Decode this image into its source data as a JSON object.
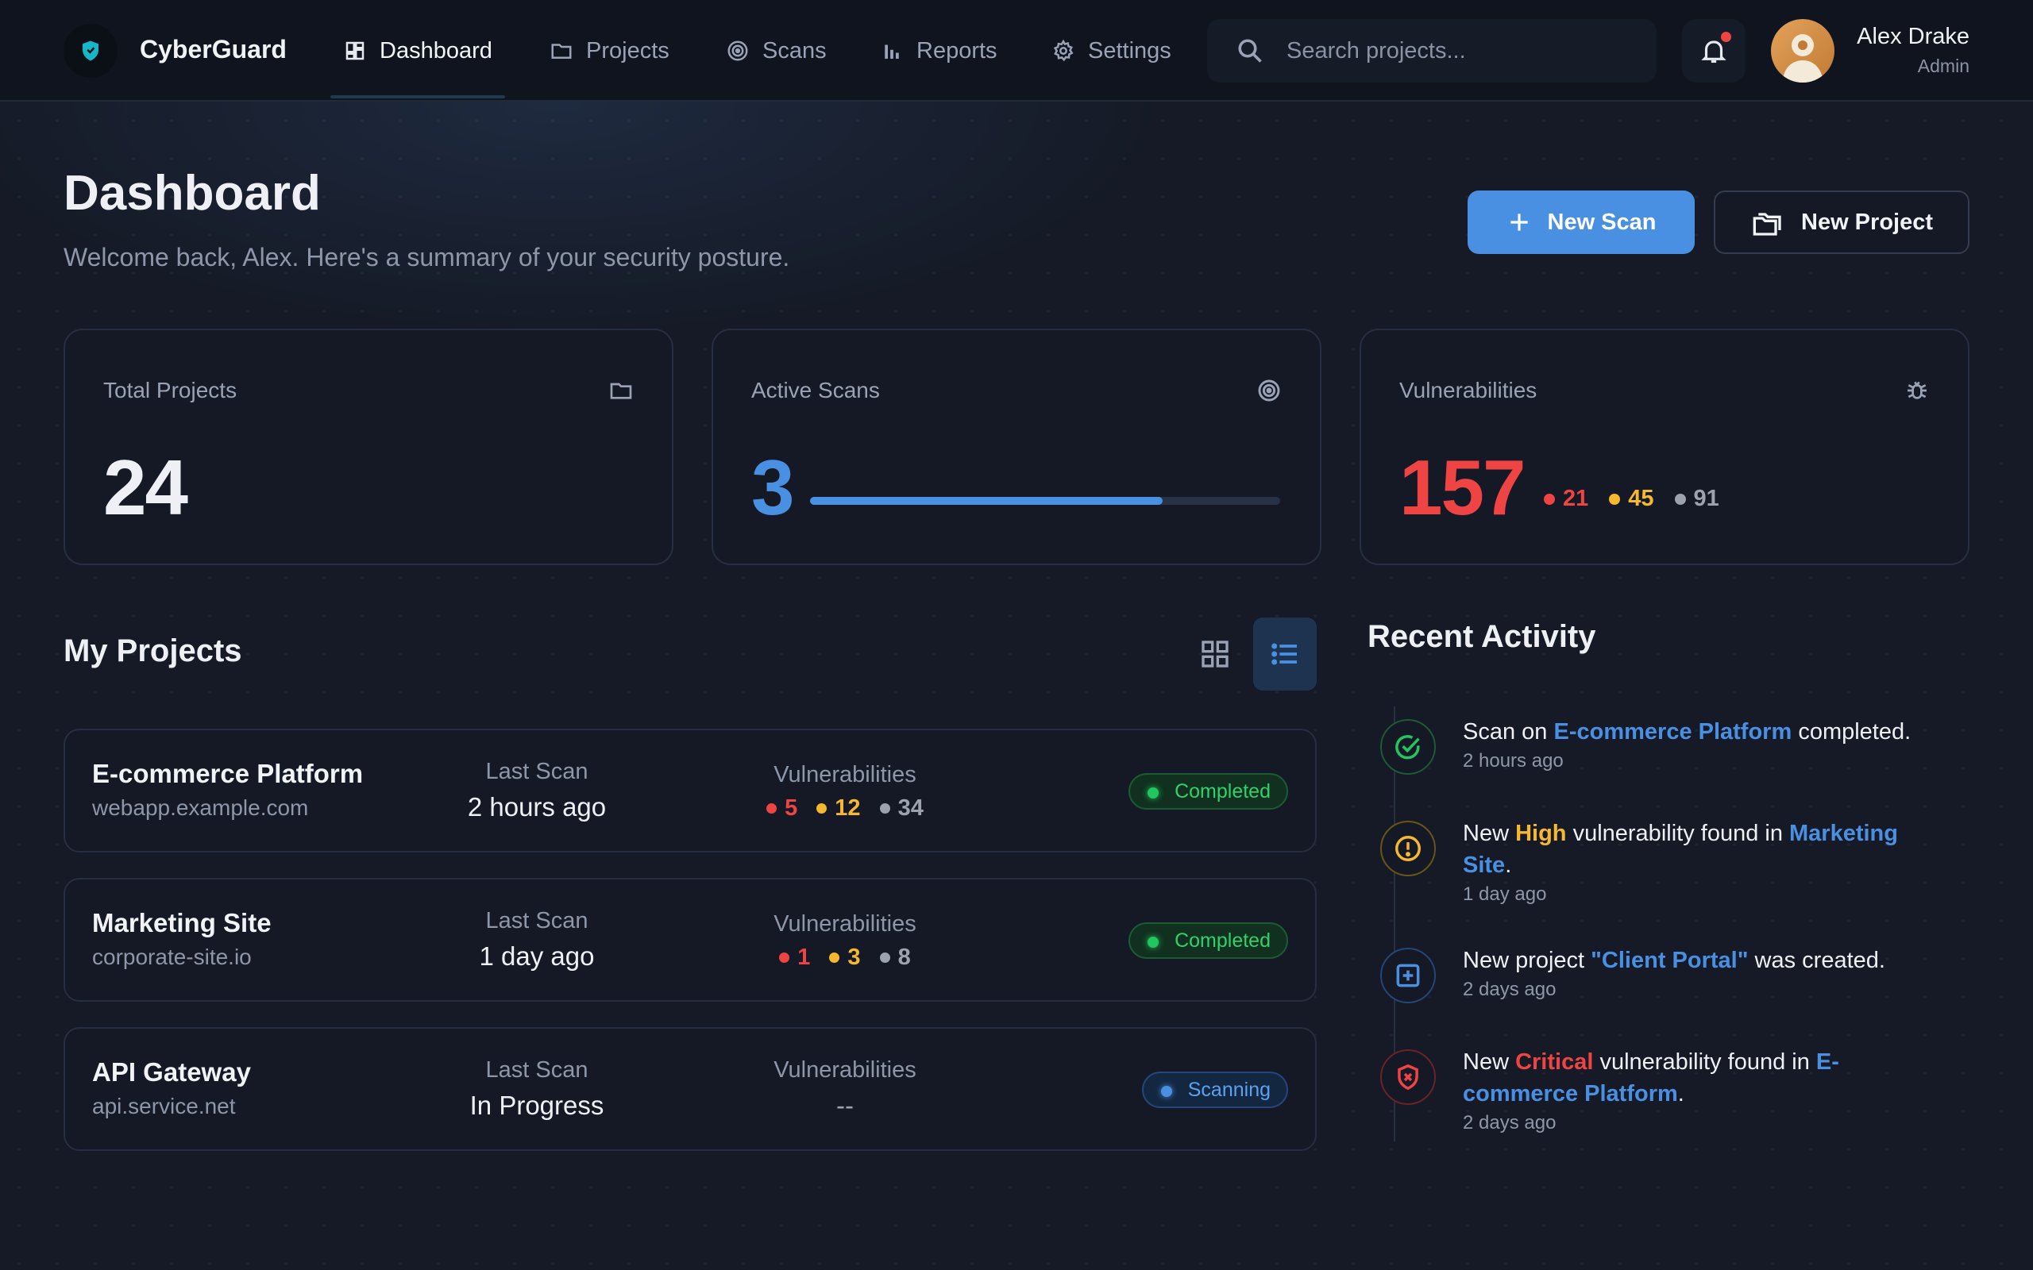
{
  "app": {
    "name": "CyberGuard"
  },
  "nav": [
    {
      "label": "Dashboard",
      "icon": "dashboard-icon",
      "active": true
    },
    {
      "label": "Projects",
      "icon": "folder-icon",
      "active": false
    },
    {
      "label": "Scans",
      "icon": "target-icon",
      "active": false
    },
    {
      "label": "Reports",
      "icon": "bar-chart-icon",
      "active": false
    },
    {
      "label": "Settings",
      "icon": "gear-icon",
      "active": false
    }
  ],
  "search": {
    "placeholder": "Search projects..."
  },
  "notifications": {
    "has_unread": true
  },
  "user": {
    "name": "Alex Drake",
    "role": "Admin"
  },
  "header": {
    "title": "Dashboard",
    "subtitle": "Welcome back, Alex. Here's a summary of your security posture.",
    "new_scan_label": "New Scan",
    "new_project_label": "New Project"
  },
  "stats": {
    "total_projects": {
      "label": "Total Projects",
      "value": "24"
    },
    "active_scans": {
      "label": "Active Scans",
      "value": "3",
      "progress": 0.75
    },
    "vulnerabilities": {
      "label": "Vulnerabilities",
      "value": "157",
      "critical": "21",
      "high": "45",
      "low": "91"
    }
  },
  "projects": {
    "title": "My Projects",
    "view": "list",
    "last_scan_label": "Last Scan",
    "vulns_label": "Vulnerabilities",
    "items": [
      {
        "name": "E-commerce Platform",
        "url": "webapp.example.com",
        "last_scan": "2 hours ago",
        "critical": "5",
        "high": "12",
        "low": "34",
        "status": "Completed",
        "state": "completed"
      },
      {
        "name": "Marketing Site",
        "url": "corporate-site.io",
        "last_scan": "1 day ago",
        "critical": "1",
        "high": "3",
        "low": "8",
        "status": "Completed",
        "state": "completed"
      },
      {
        "name": "API Gateway",
        "url": "api.service.net",
        "last_scan": "In Progress",
        "vulns_placeholder": "--",
        "status": "Scanning",
        "state": "scanning"
      }
    ]
  },
  "activity": {
    "title": "Recent Activity",
    "items": [
      {
        "icon": "check-circle-icon",
        "parts": [
          "Scan on ",
          "E-commerce Platform",
          " completed."
        ],
        "time": "2 hours ago"
      },
      {
        "icon": "alert-circle-icon",
        "parts": [
          "New ",
          "High",
          " vulnerability found in ",
          "Marketing Site",
          "."
        ],
        "time": "1 day ago"
      },
      {
        "icon": "plus-square-icon",
        "parts": [
          "New project ",
          "\"Client Portal\"",
          " was created."
        ],
        "time": "2 days ago"
      },
      {
        "icon": "shield-x-icon",
        "parts": [
          "New ",
          "Critical",
          " vulnerability found in ",
          "E-commerce Platform",
          "."
        ],
        "time": "2 days ago"
      }
    ]
  },
  "colors": {
    "accent": "#4a90e2",
    "critical": "#ef4444",
    "high": "#f5b82e",
    "low": "#9ca3af",
    "success": "#22c55e"
  }
}
